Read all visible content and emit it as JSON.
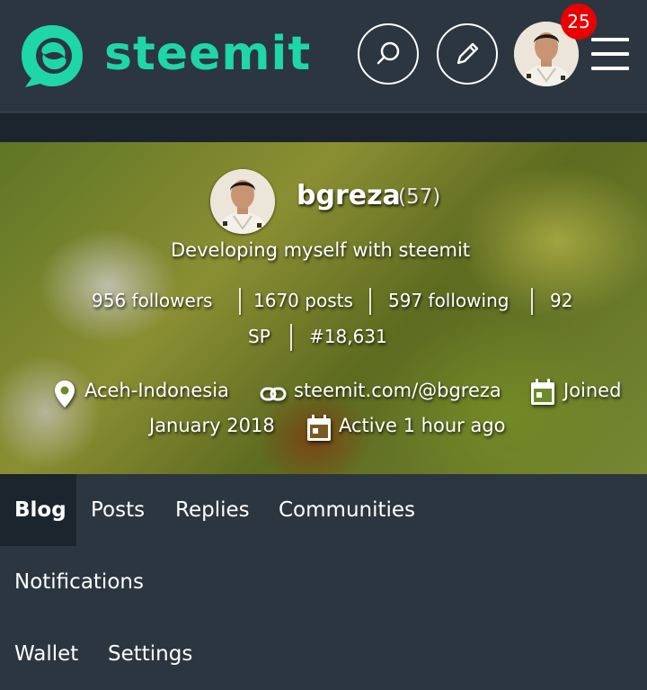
{
  "brand": {
    "name": "steemit",
    "color": "#1fd6a6"
  },
  "header": {
    "search_icon": "search-icon",
    "write_icon": "pencil-icon",
    "notification_count": "25",
    "menu_icon": "hamburger-icon"
  },
  "profile": {
    "username": "bgreza",
    "reputation": "(57)",
    "about": "Developing myself with steemit",
    "stats": {
      "followers": "956 followers",
      "posts": "1670 posts",
      "following": "597 following",
      "sp_value": "92",
      "sp_unit": "SP",
      "rank": "#18,631"
    },
    "location": "Aceh-Indonesia",
    "website": "steemit.com/@bgreza",
    "joined_label": "Joined",
    "joined_date": "January 2018",
    "active": "Active 1 hour ago"
  },
  "tabs": [
    {
      "label": "Blog",
      "active": true
    },
    {
      "label": "Posts",
      "active": false
    },
    {
      "label": "Replies",
      "active": false
    },
    {
      "label": "Communities",
      "active": false
    },
    {
      "label": "Notifications",
      "active": false
    },
    {
      "label": "Wallet",
      "active": false
    },
    {
      "label": "Settings",
      "active": false
    }
  ]
}
